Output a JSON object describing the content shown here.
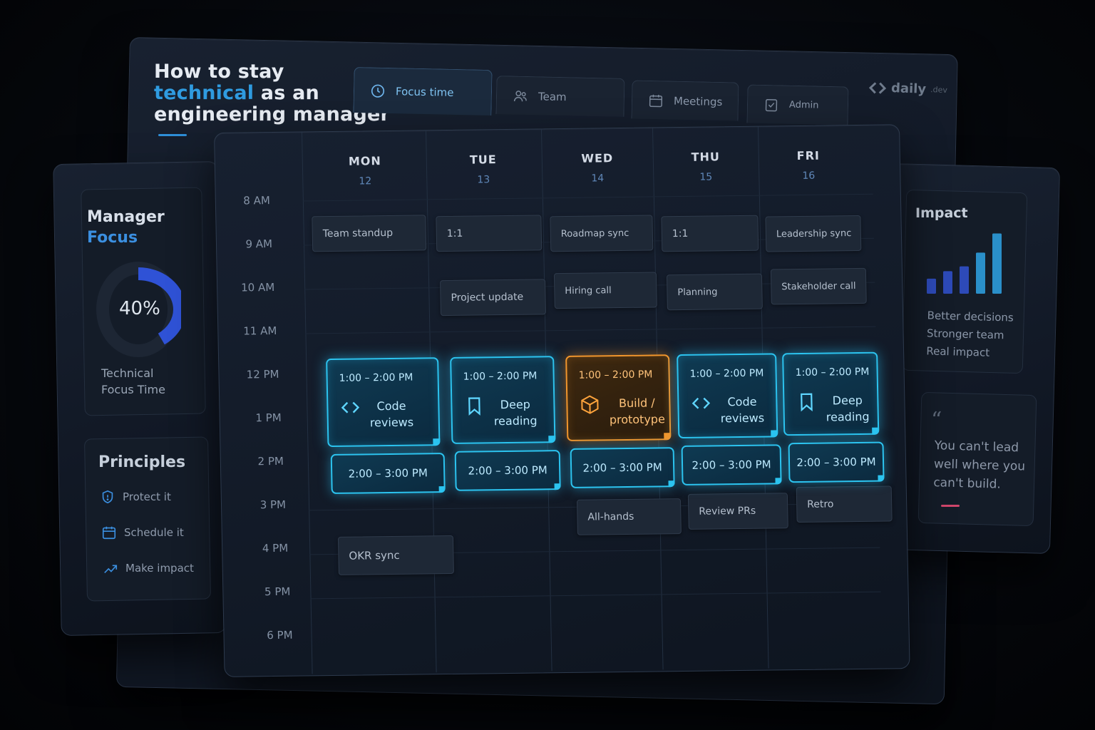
{
  "header": {
    "title_line1": "How to stay",
    "title_accent": "technical",
    "title_line2_rest": " as an",
    "title_line3": "engineering manager"
  },
  "tabs": [
    {
      "label": "Focus time",
      "icon": "clock-icon",
      "active": true
    },
    {
      "label": "Team",
      "icon": "people-icon",
      "active": false
    },
    {
      "label": "Meetings",
      "icon": "calendar-icon",
      "active": false
    },
    {
      "label": "Admin",
      "icon": "checkbox-icon",
      "active": false
    }
  ],
  "brand": {
    "name": "daily",
    "suffix": ".dev"
  },
  "manager_focus": {
    "title_line1": "Manager",
    "title_line2": "Focus",
    "percent_label": "40%",
    "percent_value": 40,
    "caption_line1": "Technical",
    "caption_line2": "Focus Time",
    "ring_color": "#2f52d6"
  },
  "principles": {
    "title": "Principles",
    "items": [
      {
        "label": "Protect it",
        "icon": "shield-icon"
      },
      {
        "label": "Schedule it",
        "icon": "calendar-icon"
      },
      {
        "label": "Make impact",
        "icon": "trend-up-icon"
      }
    ]
  },
  "impact": {
    "title": "Impact",
    "bar_levels": [
      0.22,
      0.33,
      0.4,
      0.6,
      0.88
    ],
    "items": [
      "Better decisions",
      "Stronger team",
      "Real impact"
    ]
  },
  "quote": {
    "mark": "“",
    "text": "You can't lead well where you can't build."
  },
  "calendar": {
    "days": [
      {
        "name": "MON",
        "num": "12"
      },
      {
        "name": "TUE",
        "num": "13"
      },
      {
        "name": "WED",
        "num": "14"
      },
      {
        "name": "THU",
        "num": "15"
      },
      {
        "name": "FRI",
        "num": "16"
      }
    ],
    "hours": [
      "8 AM",
      "9 AM",
      "10 AM",
      "11 AM",
      "12 PM",
      "1 PM",
      "2 PM",
      "3 PM",
      "4 PM",
      "5 PM",
      "6 PM"
    ],
    "meetings": {
      "mon_9": "Team standup",
      "tue_9": "1:1",
      "wed_9": "Roadmap sync",
      "thu_9": "1:1",
      "fri_9": "Leadership sync",
      "tue_10": "Project update",
      "wed_10": "Hiring call",
      "thu_10": "Planning",
      "fri_10": "Stakeholder call",
      "wed_3": "All-hands",
      "thu_3": "Review PRs",
      "fri_3": "Retro",
      "mon_4": "OKR sync"
    },
    "focus_blocks": [
      {
        "time": "1:00 – 2:00 PM",
        "line1": "Code",
        "line2": "reviews",
        "icon": "code-icon",
        "color": "#2cc4f0"
      },
      {
        "time": "1:00 – 2:00 PM",
        "line1": "Deep",
        "line2": "reading",
        "icon": "bookmark-icon",
        "color": "#2cc4f0"
      },
      {
        "time": "1:00 – 2:00 PM",
        "line1": "Build /",
        "line2": "prototype",
        "icon": "cube-icon",
        "color": "#f2962c"
      },
      {
        "time": "1:00 – 2:00 PM",
        "line1": "Code",
        "line2": "reviews",
        "icon": "code-icon",
        "color": "#2cc4f0"
      },
      {
        "time": "1:00 – 2:00 PM",
        "line1": "Deep",
        "line2": "reading",
        "icon": "bookmark-icon",
        "color": "#2cc4f0"
      }
    ],
    "slots": [
      "2:00 – 3:00 PM",
      "2:00 – 3:00 PM",
      "2:00 – 3:00 PM",
      "2:00 – 3:00 PM",
      "2:00 – 3:00 PM"
    ]
  }
}
